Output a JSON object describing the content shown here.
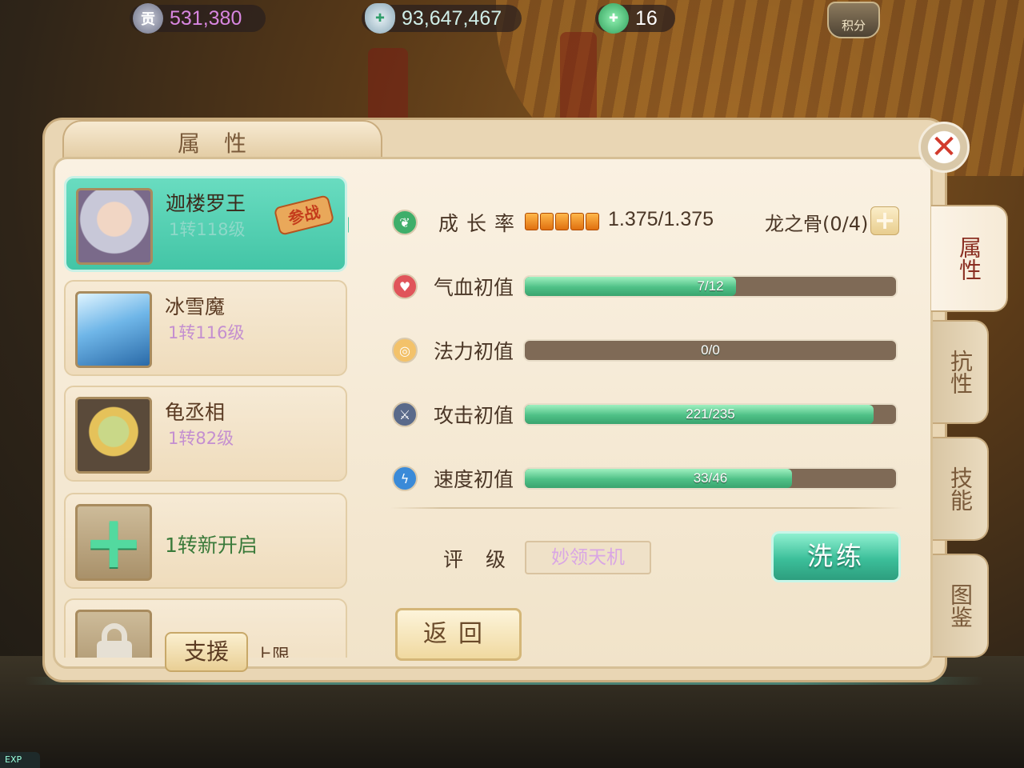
{
  "resources": {
    "contribution": {
      "icon": "contribution-coin-icon",
      "glyph": "贡",
      "value": "531,380",
      "color": "#d886e0"
    },
    "silver": {
      "icon": "silver-ingot-icon",
      "value": "93,647,467",
      "color": "#cfeee8"
    },
    "jade": {
      "icon": "jade-coin-icon",
      "value": "16",
      "color": "#ffffff"
    },
    "score_label": "积分"
  },
  "panel": {
    "title": "属性",
    "close_glyph": "✕"
  },
  "side_tabs": [
    {
      "label": "属性",
      "active": true
    },
    {
      "label": "抗性",
      "active": false
    },
    {
      "label": "技能",
      "active": false
    },
    {
      "label": "图鉴",
      "active": false
    }
  ],
  "pets": [
    {
      "name": "迦楼罗王",
      "level": "1转118级",
      "battle_badge": "参战",
      "selected": true
    },
    {
      "name": "冰雪魔",
      "level": "1转116级",
      "selected": false
    },
    {
      "name": "龟丞相",
      "level": "1转82级",
      "selected": false
    }
  ],
  "unlock_slot": {
    "label": "1转新开启"
  },
  "locked_slot": {
    "text": "上限"
  },
  "assist_label": "支援",
  "growth": {
    "label": "成长率",
    "pips": 5,
    "value": "1.375/1.375",
    "bone_label": "龙之骨(0/4)",
    "plus": "+"
  },
  "stats": [
    {
      "key": "hp",
      "label": "气血初值",
      "icon": "heart-icon",
      "glyph": "♥",
      "icon_color": "#e0545a",
      "value_text": "7/12",
      "fill": 0.57
    },
    {
      "key": "mp",
      "label": "法力初值",
      "icon": "mana-ring-icon",
      "glyph": "◎",
      "icon_color": "#e59a3a",
      "value_text": "0/0",
      "fill": 0
    },
    {
      "key": "atk",
      "label": "攻击初值",
      "icon": "sword-icon",
      "glyph": "⚔",
      "icon_color": "#5a6a8a",
      "value_text": "221/235",
      "fill": 0.94
    },
    {
      "key": "spd",
      "label": "速度初值",
      "icon": "lightning-icon",
      "glyph": "ϟ",
      "icon_color": "#3a8ad8",
      "value_text": "33/46",
      "fill": 0.72
    }
  ],
  "rating": {
    "label": "评级",
    "value": "妙领天机"
  },
  "buttons": {
    "wash": "洗练",
    "back": "返回"
  },
  "exp_tag": "EXP"
}
